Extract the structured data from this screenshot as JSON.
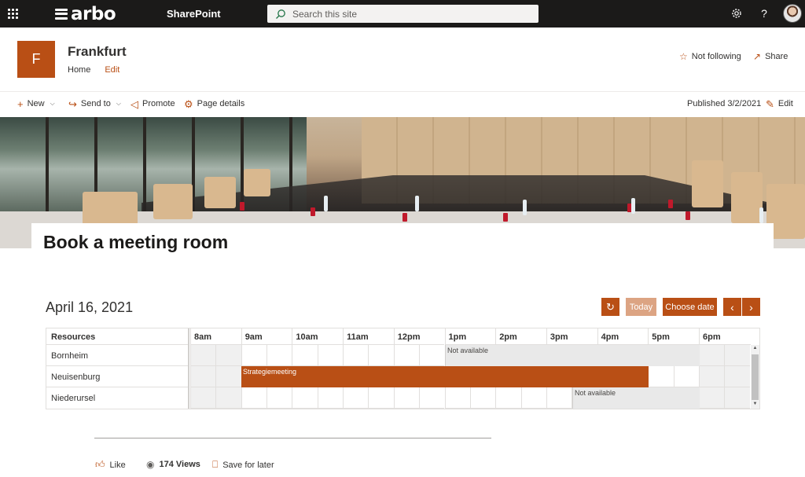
{
  "topbar": {
    "logo_text": "arbo",
    "app_name": "SharePoint",
    "search_placeholder": "Search this site"
  },
  "site": {
    "logo_letter": "F",
    "title": "Frankfurt",
    "nav": [
      "Home",
      "Edit"
    ],
    "follow_label": "Not following",
    "share_label": "Share"
  },
  "commandbar": {
    "new_label": "New",
    "send_label": "Send to",
    "promote_label": "Promote",
    "details_label": "Page details",
    "published": "Published 3/2/2021",
    "edit_label": "Edit"
  },
  "page": {
    "title": "Book a meeting room"
  },
  "calendar": {
    "date": "April 16, 2021",
    "today_label": "Today",
    "choose_label": "Choose date",
    "prev_icon": "‹",
    "next_icon": "›",
    "resources_header": "Resources",
    "hours": [
      "8am",
      "9am",
      "10am",
      "11am",
      "12pm",
      "1pm",
      "2pm",
      "3pm",
      "4pm",
      "5pm",
      "6pm"
    ],
    "resources": [
      "Bornheim",
      "Neuisenburg",
      "Niederursel"
    ],
    "events": [
      {
        "resource": "Bornheim",
        "label": "Not available",
        "kind": "unavailable"
      },
      {
        "resource": "Neuisenburg",
        "label": "Strategiemeeting",
        "kind": "booking"
      },
      {
        "resource": "Niederursel",
        "label": "Not available",
        "kind": "unavailable"
      }
    ]
  },
  "footer": {
    "like_label": "Like",
    "views_label": "174 Views",
    "save_label": "Save for later"
  },
  "colors": {
    "accent": "#b94f15",
    "suite_bar": "#1b1a19"
  }
}
